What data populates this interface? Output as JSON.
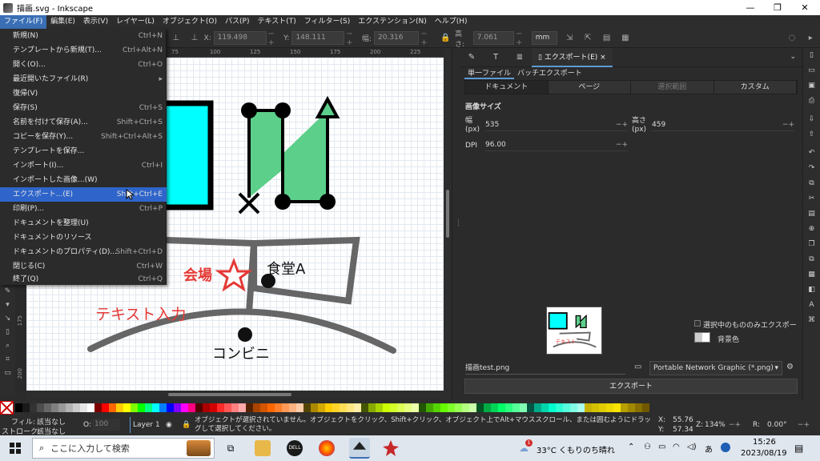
{
  "window": {
    "title": "描画.svg - Inkscape",
    "minimize": "—",
    "maximize": "❐",
    "close": "✕"
  },
  "menubar": [
    "ファイル(F)",
    "編集(E)",
    "表示(V)",
    "レイヤー(L)",
    "オブジェクト(O)",
    "パス(P)",
    "テキスト(T)",
    "フィルター(S)",
    "エクステンション(N)",
    "ヘルプ(H)"
  ],
  "toolbar": {
    "x_label": "X:",
    "x_value": "119.498",
    "y_label": "Y:",
    "y_value": "148.111",
    "w_label": "幅:",
    "w_value": "20.316",
    "h_label": "高さ:",
    "h_value": "7.061",
    "unit": "mm"
  },
  "file_menu": [
    {
      "label": "新規(N)",
      "shortcut": "Ctrl+N"
    },
    {
      "label": "テンプレートから新規(T)...",
      "shortcut": "Ctrl+Alt+N"
    },
    {
      "label": "開く(O)...",
      "shortcut": "Ctrl+O"
    },
    {
      "label": "最近開いたファイル(R)",
      "shortcut": "▸"
    },
    {
      "label": "復帰(V)",
      "shortcut": ""
    },
    {
      "label": "保存(S)",
      "shortcut": "Ctrl+S"
    },
    {
      "label": "名前を付けて保存(A)...",
      "shortcut": "Shift+Ctrl+S"
    },
    {
      "label": "コピーを保存(Y)...",
      "shortcut": "Shift+Ctrl+Alt+S"
    },
    {
      "label": "テンプレートを保存...",
      "shortcut": ""
    },
    {
      "label": "インポート(I)...",
      "shortcut": "Ctrl+I"
    },
    {
      "label": "インポートした画像...(W)",
      "shortcut": ""
    },
    {
      "label": "エクスポート...(E)",
      "shortcut": "Shift+Ctrl+E",
      "highlighted": true
    },
    {
      "label": "印刷(P)...",
      "shortcut": "Ctrl+P"
    },
    {
      "label": "ドキュメントを整理(U)",
      "shortcut": ""
    },
    {
      "label": "ドキュメントのリソース",
      "shortcut": ""
    },
    {
      "label": "ドキュメントのプロパティ(D)...",
      "shortcut": "Shift+Ctrl+D"
    },
    {
      "label": "閉じる(C)",
      "shortcut": "Ctrl+W"
    },
    {
      "label": "終了(Q)",
      "shortcut": "Ctrl+Q"
    }
  ],
  "ruler": {
    "top": [
      "75",
      "100",
      "125",
      "150",
      "175",
      "200",
      "225"
    ],
    "left": [
      "175",
      "200"
    ]
  },
  "canvas": {
    "kaijo": "会場",
    "shokudo": "食堂A",
    "text_input": "テキスト入力",
    "konbini": "コンビニ",
    "accent_red": "#e53935",
    "cyan": "#00ffff",
    "green": "#5ccf8a"
  },
  "export_panel": {
    "tab_label": "エクスポート(E)",
    "tab_close": "×",
    "subtab_single": "単一ファイル",
    "subtab_batch": "バッチエクスポート",
    "seg_document": "ドキュメント",
    "seg_page": "ページ",
    "seg_selection": "選択範囲",
    "seg_custom": "カスタム",
    "section_title": "画像サイズ",
    "width_label": "幅\n(px)",
    "width_value": "535",
    "height_label": "高さ\n(px)",
    "height_value": "459",
    "dpi_label": "DPI",
    "dpi_value": "96.00",
    "export_selected_only": "選択中のもののみエクスポート",
    "background_color": "背景色",
    "filename": "描画test.png",
    "format": "Portable Network Graphic (*.png)",
    "export_button": "エクスポート"
  },
  "statusbar": {
    "fill_label": "フィル:",
    "fill_value": "該当なし",
    "stroke_label": "ストローク:",
    "stroke_value": "該当なし",
    "opacity_label": "O:",
    "opacity_value": "100",
    "layer": "Layer 1",
    "message": "オブジェクトが選択されていません。オブジェクトをクリック、Shift+クリック、オブジェクト上でAlt+マウススクロール、または囲むようにドラッグして選択してください。",
    "x_label": "X:",
    "x_value": "55.76",
    "y_label": "Y:",
    "y_value": "57.34",
    "zoom_label": "Z:",
    "zoom_value": "134%",
    "rot_label": "R:",
    "rot_value": "0.00°"
  },
  "taskbar": {
    "search_placeholder": "ここに入力して検索",
    "weather": "33°C くもりのち晴れ",
    "weather_badge": "1",
    "time": "15:26",
    "date": "2023/08/19",
    "ime": "あ"
  }
}
